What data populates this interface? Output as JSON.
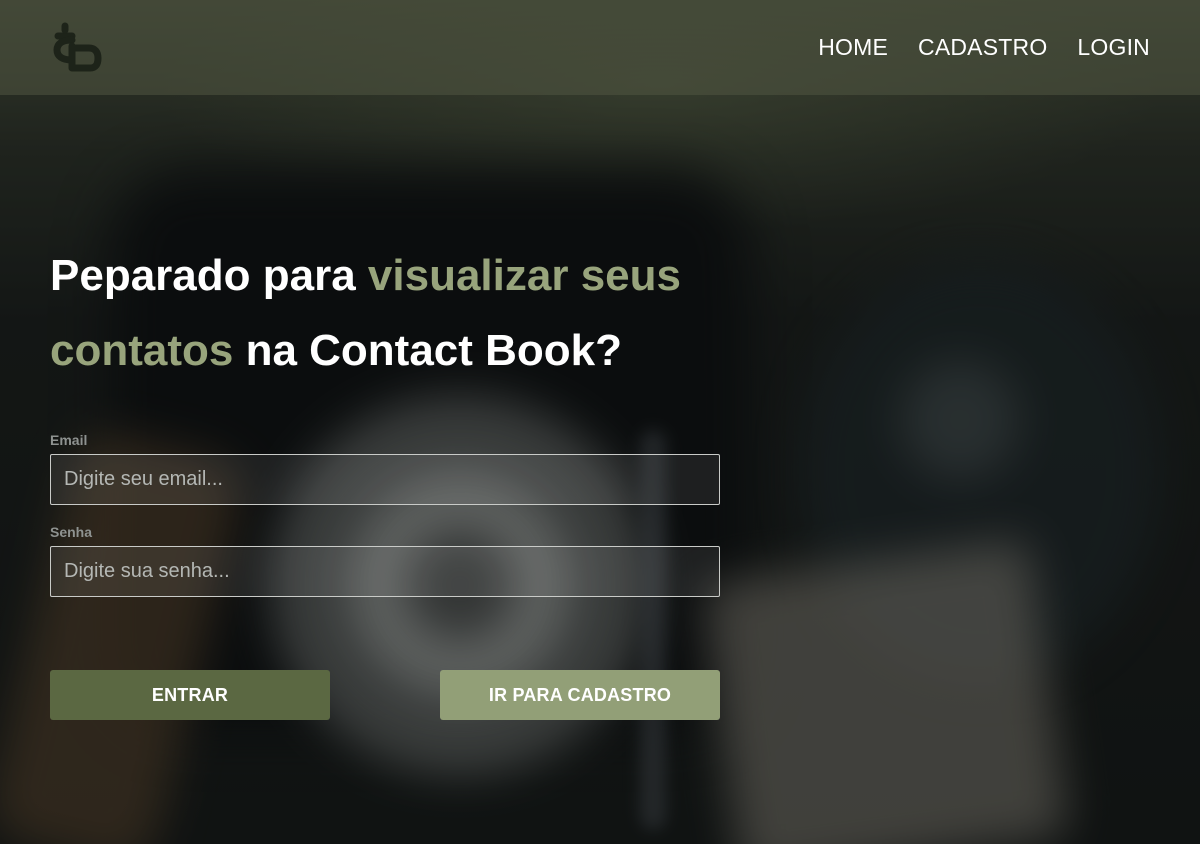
{
  "header": {
    "logo_icon": "contact-book-logo-icon",
    "nav": [
      {
        "label": "HOME"
      },
      {
        "label": "CADASTRO"
      },
      {
        "label": "LOGIN"
      }
    ]
  },
  "hero": {
    "headline_part1": "Peparado para ",
    "headline_accent1": "visualizar seus contatos",
    "headline_part2": " na Contact Book?"
  },
  "form": {
    "email_label": "Email",
    "email_placeholder": "Digite seu email...",
    "email_value": "",
    "password_label": "Senha",
    "password_placeholder": "Digite sua senha...",
    "password_value": ""
  },
  "buttons": {
    "login_label": "ENTRAR",
    "register_label": "IR PARA CADASTRO"
  },
  "colors": {
    "accent": "#98a47c",
    "primary_button": "#5b6842",
    "secondary_button": "#929f77",
    "header_bg": "#505642"
  }
}
